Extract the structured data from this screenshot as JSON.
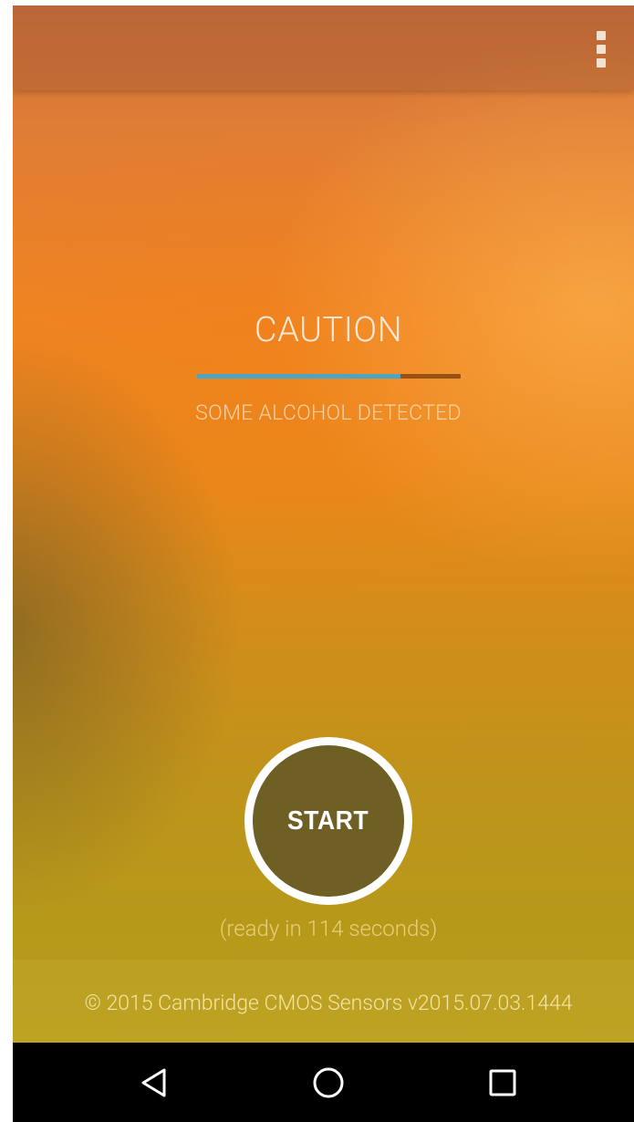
{
  "app": {
    "menu_icon": "more-vert-icon"
  },
  "status": {
    "title": "CAUTION",
    "subtitle": "SOME ALCOHOL DETECTED",
    "progress_fraction": 0.77,
    "progress_color": "#4aa6c4",
    "track_color": "#9a5116"
  },
  "start": {
    "label": "START",
    "ready_text": "(ready in 114 seconds)"
  },
  "footer": {
    "copyright": "© 2015 Cambridge CMOS Sensors v2015.07.03.1444"
  },
  "navbar": {
    "back_icon": "back-triangle-icon",
    "home_icon": "home-circle-icon",
    "recents_icon": "recents-square-icon"
  }
}
